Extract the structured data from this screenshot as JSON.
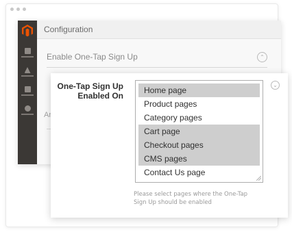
{
  "window": {
    "controls": [
      "close",
      "minimize",
      "maximize"
    ]
  },
  "admin": {
    "title": "Configuration",
    "sidebar": {
      "logo_icon": "magento-logo-icon",
      "items": [
        {
          "icon": "dashboard-icon"
        },
        {
          "icon": "sales-icon"
        },
        {
          "icon": "stores-icon"
        },
        {
          "icon": "system-icon"
        }
      ]
    },
    "section": {
      "label": "Enable One-Tap Sign Up",
      "icon": "chevron-up-icon"
    },
    "ghost_label": "Ar"
  },
  "panel": {
    "field_label": "One-Tap Sign Up Enabled On",
    "options": [
      {
        "label": "Home page",
        "selected": true
      },
      {
        "label": "Product pages",
        "selected": false
      },
      {
        "label": "Category pages",
        "selected": false
      },
      {
        "label": "Cart page",
        "selected": true
      },
      {
        "label": "Checkout pages",
        "selected": true
      },
      {
        "label": "CMS pages",
        "selected": true
      },
      {
        "label": "Contact Us page",
        "selected": false
      }
    ],
    "help_icon": "chevron-down-icon",
    "note": "Please select pages where the One-Tap Sign Up should be enabled"
  },
  "colors": {
    "selected_bg": "#cecece",
    "sidebar_bg": "#3b3835",
    "brand": "#eb5202"
  }
}
